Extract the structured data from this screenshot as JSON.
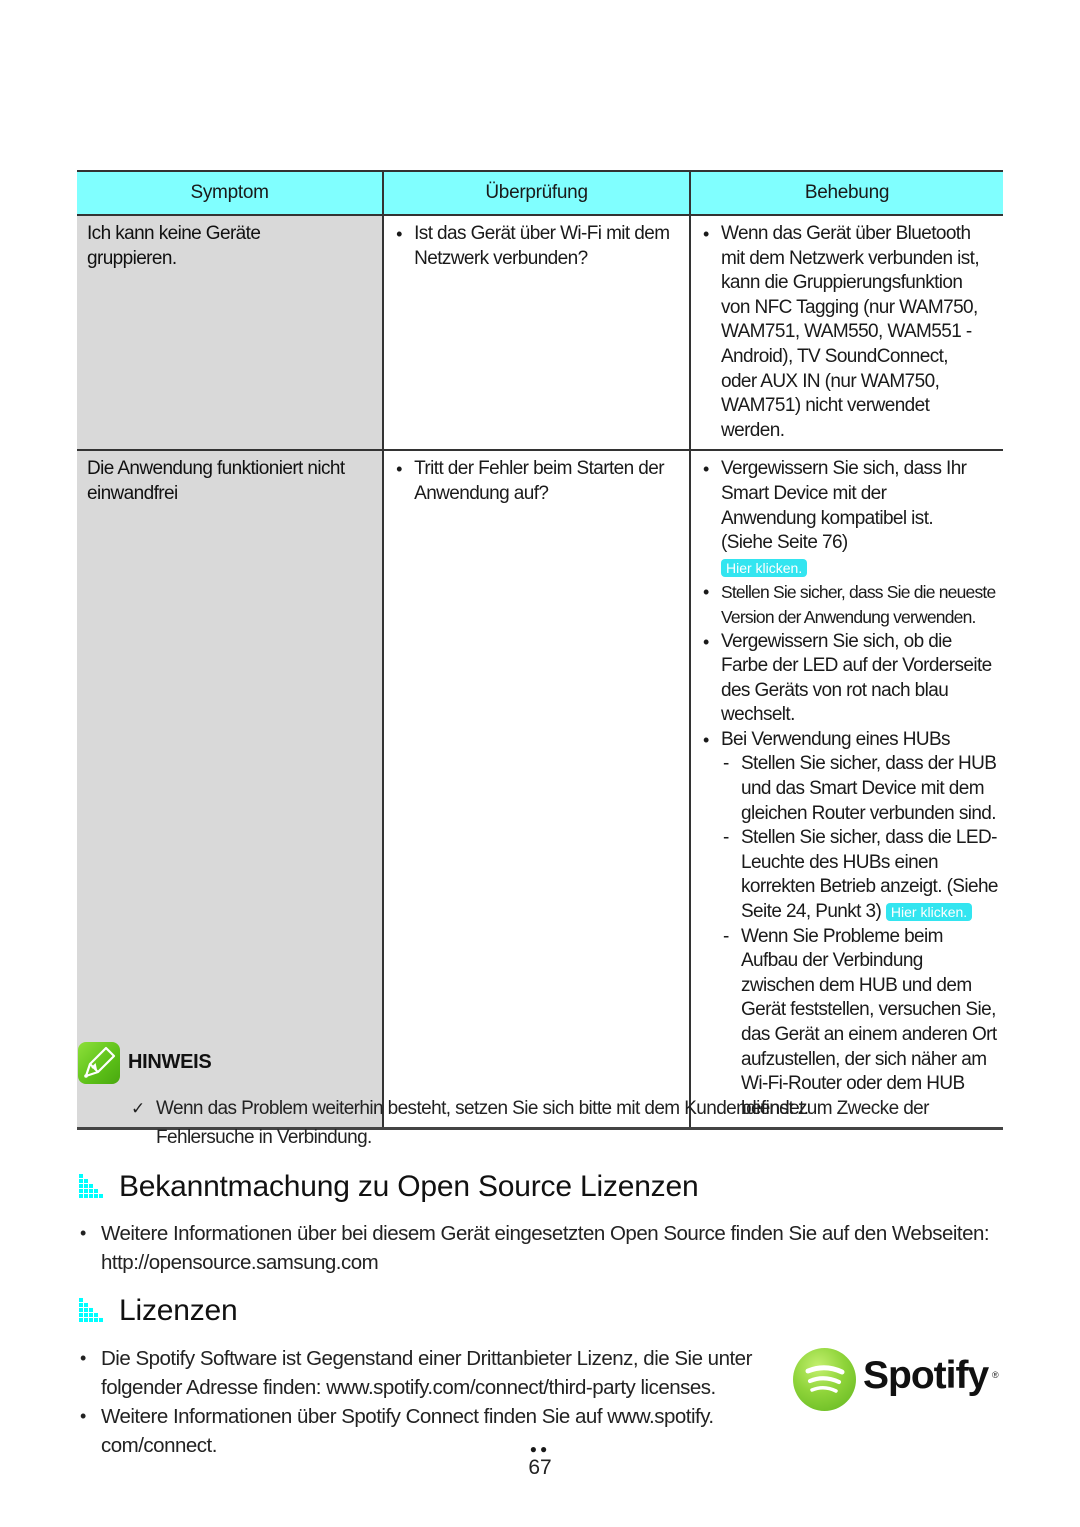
{
  "table": {
    "headers": [
      "Symptom",
      "Überprüfung",
      "Behebung"
    ],
    "rows": [
      {
        "symptom": "Ich kann keine Geräte gruppieren.",
        "check": [
          "Ist das Gerät über Wi-Fi mit dem Netzwerk verbunden?"
        ],
        "fix": [
          "Wenn das Gerät über Bluetooth mit dem Netzwerk verbunden ist, kann die Gruppierungsfunktion von NFC Tagging (nur WAM750, WAM751, WAM550, WAM551 - Android), TV SoundConnect, oder AUX IN (nur WAM750, WAM751) nicht verwendet werden."
        ]
      },
      {
        "symptom": "Die Anwendung funktioniert nicht einwandfrei",
        "check": [
          "Tritt der Fehler beim Starten der Anwendung auf?"
        ],
        "fix": {
          "item1": "Vergewissern Sie sich, dass Ihr Smart Device mit der Anwendung kompatibel ist. (Siehe Seite 76)",
          "item1_link": "Hier klicken.",
          "item2": "Stellen Sie sicher, dass Sie die neueste Version der Anwendung verwenden.",
          "item3": "Vergewissern Sie sich, ob die Farbe der LED auf der Vorderseite des Geräts von rot nach blau wechselt.",
          "item4": "Bei Verwendung eines HUBs",
          "sub1": "Stellen Sie sicher, dass der HUB und das Smart Device mit dem gleichen Router verbunden sind.",
          "sub2": "Stellen Sie sicher, dass die LED-Leuchte des HUBs einen korrekten Betrieb anzeigt. (Siehe Seite 24, Punkt 3)",
          "sub2_link": "Hier klicken.",
          "sub3": "Wenn Sie Probleme beim Aufbau der Verbindung zwischen dem HUB und dem Gerät feststellen, versuchen Sie, das Gerät an einem anderen Ort aufzustellen, der sich näher am Wi-Fi-Router oder dem HUB befindet."
        }
      }
    ]
  },
  "note": {
    "icon": "pencil-note-icon",
    "title": "HINWEIS",
    "check_icon": "✓",
    "text": "Wenn das Problem weiterhin besteht, setzen Sie sich bitte mit dem Kundendienst zum Zwecke der Fehlersuche in Verbindung."
  },
  "sections": [
    {
      "icon": "cyan-dot-grid-icon",
      "title": "Bekanntmachung zu Open Source Lizenzen",
      "bullets": [
        "Weitere Informationen über bei diesem Gerät eingesetzten Open Source finden Sie auf den Webseiten: http://opensource.samsung.com"
      ]
    },
    {
      "icon": "cyan-dot-grid-icon",
      "title": "Lizenzen",
      "bullets": [
        "Die Spotify Software ist Gegenstand einer Drittanbieter Lizenz, die Sie unter folgender Adresse finden: www.spotify.com/connect/third-party licenses.",
        "Weitere Informationen über Spotify Connect finden Sie auf www.spotify. com/connect."
      ]
    }
  ],
  "spotify_logo": {
    "word": "Spotify",
    "reg": "®",
    "color": "#84d12f"
  },
  "colors": {
    "header_bg": "#80ffff",
    "symptom_bg": "#d9d9d9",
    "link_bg": "#33e5f0",
    "accent_cyan": "#00ffff"
  },
  "page": {
    "number": "67"
  }
}
